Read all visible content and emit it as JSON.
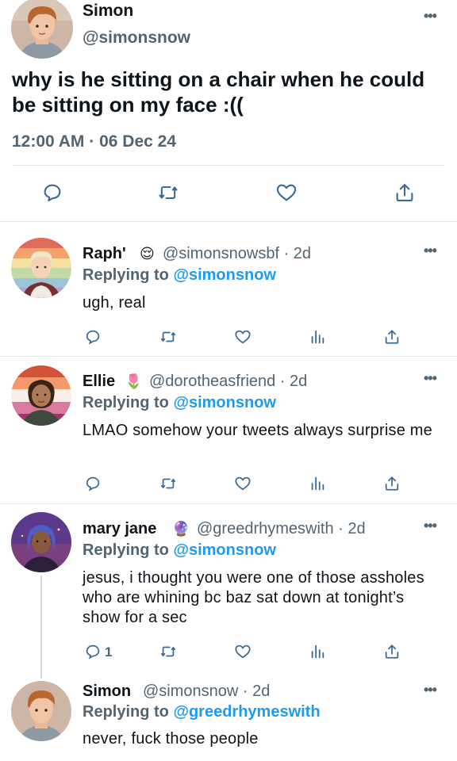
{
  "main_tweet": {
    "author_name": "Simon",
    "author_handle": "@simonsnow",
    "text": "why is he sitting on a chair when he could be sitting on my face :((",
    "timestamp": "12:00 AM · 06 Dec 24",
    "more_label": "•••",
    "actions": [
      "reply-icon",
      "retweet-icon",
      "like-icon",
      "share-icon"
    ]
  },
  "replies": [
    {
      "name": "Raph'",
      "emoji": "😌",
      "handle_time": "@simonsnowsbf · 2d",
      "replying_prefix": "Replying to ",
      "replying_to": "@simonsnow",
      "text": "ugh, real",
      "reply_count": "",
      "more_label": "•••"
    },
    {
      "name": "Ellie",
      "emoji": "🌷",
      "handle_time": "@dorotheasfriend · 2d",
      "replying_prefix": "Replying to ",
      "replying_to": "@simonsnow",
      "text": "LMAO somehow your tweets always surprise me",
      "reply_count": "",
      "more_label": "•••"
    },
    {
      "name": "mary jane",
      "emoji": "🔮",
      "handle_time": "@greedrhymeswith · 2d",
      "replying_prefix": "Replying to ",
      "replying_to": "@simonsnow",
      "text": "jesus, i thought you were one of those assholes who are whining bc baz sat down at tonight’s show for a sec",
      "reply_count": "1",
      "more_label": "•••"
    },
    {
      "name": "Simon",
      "emoji": "",
      "handle_time": "@simonsnow · 2d",
      "replying_prefix": "Replying to ",
      "replying_to": "@greedrhymeswith",
      "text": "never, fuck those people",
      "reply_count": "",
      "more_label": "•••"
    }
  ],
  "colors": {
    "text_primary": "#0f1419",
    "text_secondary": "#536471",
    "link": "#1d9bf0",
    "divider": "#e2e7eb"
  }
}
